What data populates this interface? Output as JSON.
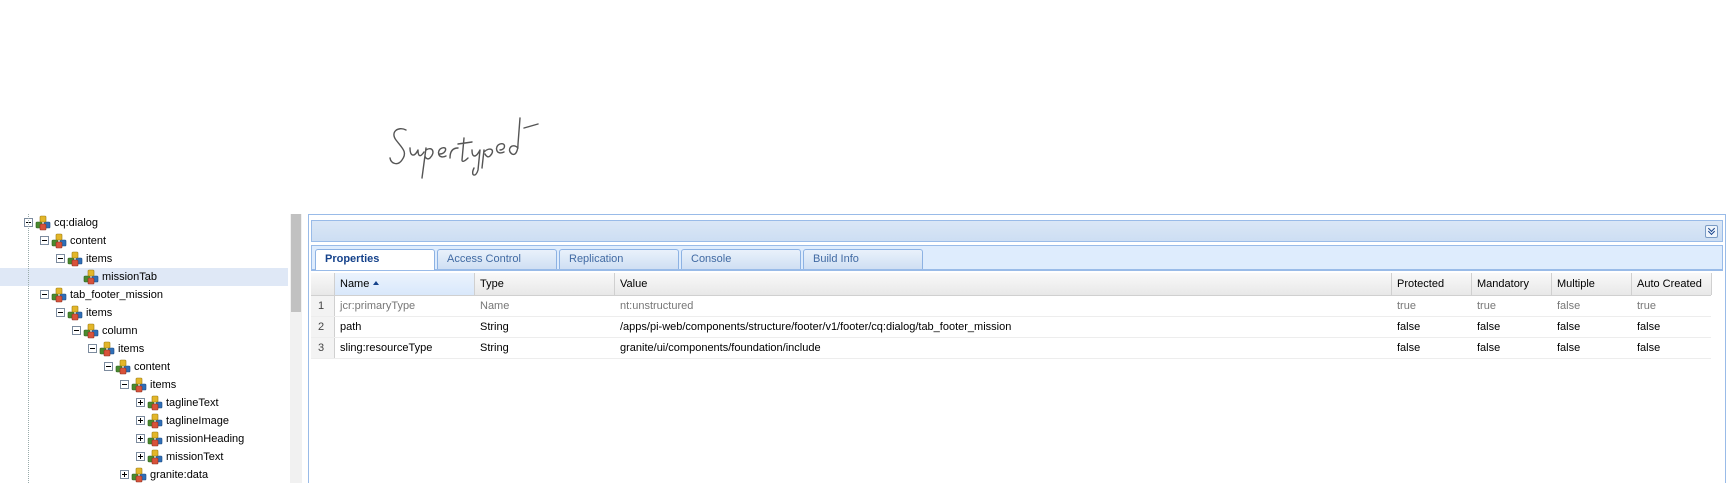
{
  "signature_text": "Supertyped",
  "tree": {
    "nodes": [
      {
        "label": "cq:dialog",
        "level": 0,
        "toggle": "collapse"
      },
      {
        "label": "content",
        "level": 1,
        "toggle": "collapse"
      },
      {
        "label": "items",
        "level": 2,
        "toggle": "collapse"
      },
      {
        "label": "missionTab",
        "level": 3,
        "toggle": "none",
        "selected": true
      },
      {
        "label": "tab_footer_mission",
        "level": 1,
        "toggle": "collapse"
      },
      {
        "label": "items",
        "level": 2,
        "toggle": "collapse"
      },
      {
        "label": "column",
        "level": 3,
        "toggle": "collapse"
      },
      {
        "label": "items",
        "level": 4,
        "toggle": "collapse"
      },
      {
        "label": "content",
        "level": 5,
        "toggle": "collapse"
      },
      {
        "label": "items",
        "level": 6,
        "toggle": "collapse"
      },
      {
        "label": "taglineText",
        "level": 7,
        "toggle": "expand"
      },
      {
        "label": "taglineImage",
        "level": 7,
        "toggle": "expand"
      },
      {
        "label": "missionHeading",
        "level": 7,
        "toggle": "expand"
      },
      {
        "label": "missionText",
        "level": 7,
        "toggle": "expand"
      },
      {
        "label": "granite:data",
        "level": 6,
        "toggle": "expand"
      }
    ]
  },
  "tabs": [
    {
      "label": "Properties",
      "active": true
    },
    {
      "label": "Access Control",
      "active": false
    },
    {
      "label": "Replication",
      "active": false
    },
    {
      "label": "Console",
      "active": false
    },
    {
      "label": "Build Info",
      "active": false
    }
  ],
  "grid": {
    "sort_column": "Name",
    "columns": [
      "Name",
      "Type",
      "Value",
      "Protected",
      "Mandatory",
      "Multiple",
      "Auto Created"
    ],
    "rows": [
      {
        "num": "1",
        "name": "jcr:primaryType",
        "type": "Name",
        "value": "nt:unstructured",
        "protected": "true",
        "mandatory": "true",
        "multiple": "false",
        "auto_created": "true"
      },
      {
        "num": "2",
        "name": "path",
        "type": "String",
        "value": "/apps/pi-web/components/structure/footer/v1/footer/cq:dialog/tab_footer_mission",
        "protected": "false",
        "mandatory": "false",
        "multiple": "false",
        "auto_created": "false"
      },
      {
        "num": "3",
        "name": "sling:resourceType",
        "type": "String",
        "value": "granite/ui/components/foundation/include",
        "protected": "false",
        "mandatory": "false",
        "multiple": "false",
        "auto_created": "false"
      }
    ]
  },
  "icons": {
    "node": "node-icon",
    "collapse": "collapse-icon",
    "expand": "expand-icon",
    "sort": "sort-ascending-icon",
    "panel_toggle": "double-chevron-down-icon"
  },
  "colors": {
    "panel_border": "#99bbe8",
    "tab_active_text": "#15428b",
    "tab_text": "#416aa3",
    "selection": "#dfe8f6"
  }
}
